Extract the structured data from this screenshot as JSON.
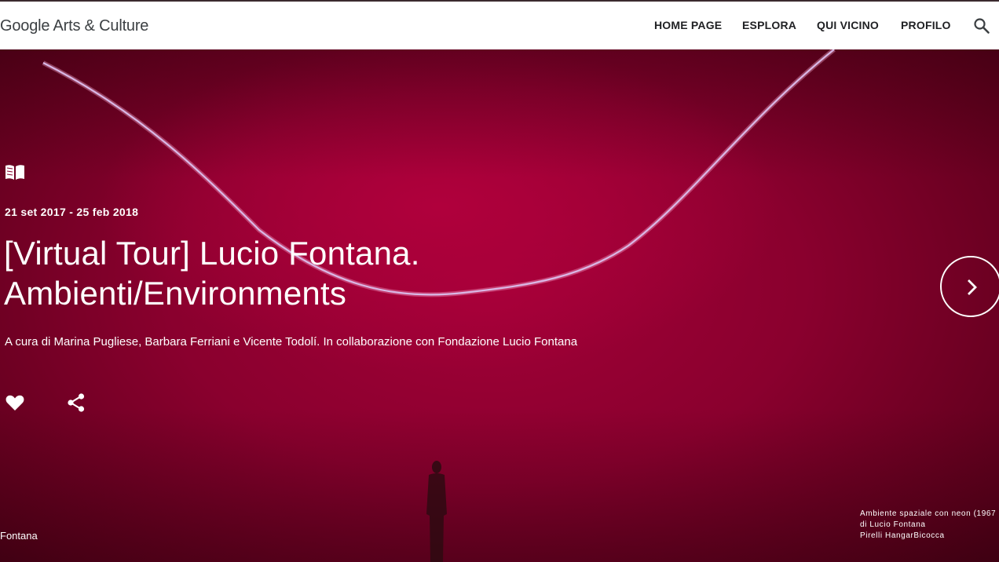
{
  "header": {
    "logo": "Google Arts & Culture",
    "nav": {
      "home": "HOME PAGE",
      "explore": "ESPLORA",
      "nearby": "QUI VICINO",
      "profile": "PROFILO"
    },
    "search_icon": "search-icon"
  },
  "hero": {
    "date": "21 set 2017 - 25 feb 2018",
    "title_line1": "[Virtual Tour] Lucio Fontana.",
    "title_line2": "Ambienti/Environments",
    "curator": "A cura di Marina Pugliese, Barbara Ferriani e Vicente Todolí. In collaborazione con Fondazione Lucio Fontana",
    "left_caption": "Fontana",
    "credit": {
      "line1": "Ambiente spaziale con neon (1967",
      "line2": "di Lucio Fontana",
      "line3": "Pirelli HangarBicocca"
    },
    "icons": [
      "book-open-icon",
      "heart-icon",
      "share-icon",
      "chevron-right-icon"
    ]
  },
  "colors": {
    "header_bg": "#ffffff",
    "hero_red": "#a30038",
    "text_light": "#ffffff",
    "nav_text": "#202124"
  }
}
